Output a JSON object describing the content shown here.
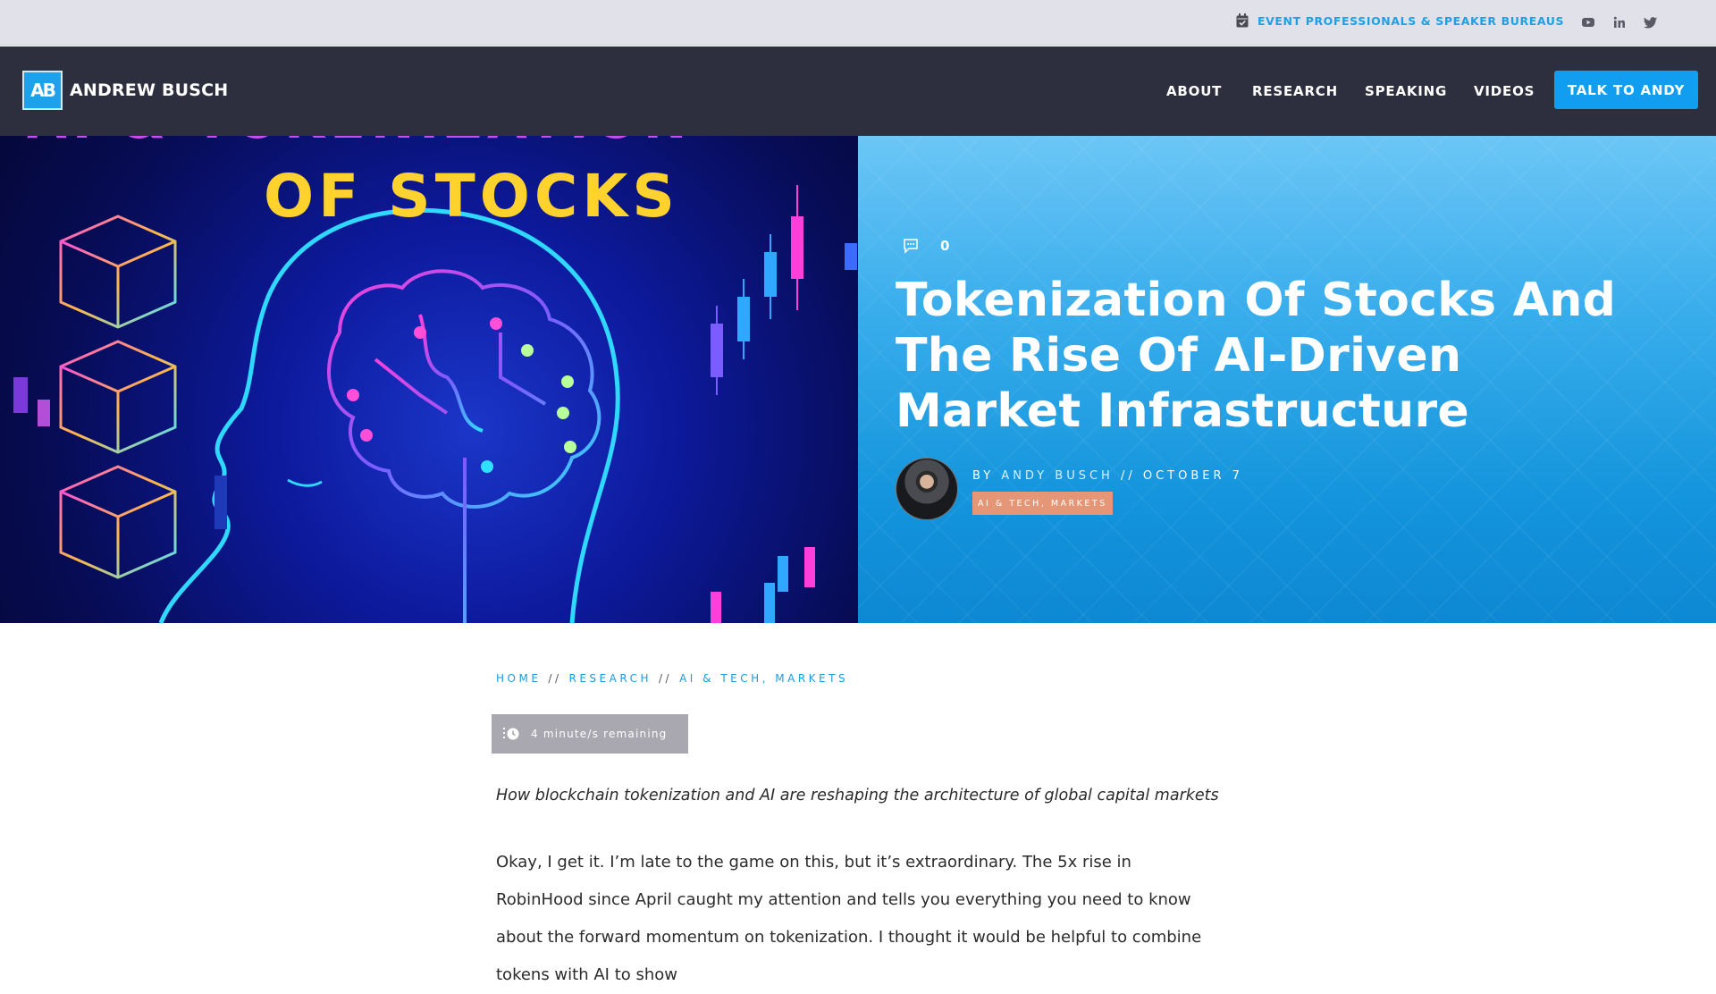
{
  "topbar": {
    "events_link": "EVENT PROFESSIONALS & SPEAKER BUREAUS",
    "events_icon": "calendar-check-icon",
    "social_icons": [
      "youtube-icon",
      "linkedin-icon",
      "twitter-icon"
    ]
  },
  "nav": {
    "logo_mark": "AB",
    "logo_name": "ANDREW BUSCH",
    "items": [
      "ABOUT",
      "RESEARCH",
      "SPEAKING",
      "VIDEOS"
    ],
    "cta": "TALK TO ANDY"
  },
  "hero": {
    "image_heading": "OF STOCKS",
    "comment_count": "0",
    "title": "Tokenization Of Stocks And The Rise Of AI-Driven Market Infrastructure",
    "by": "BY",
    "author": "ANDY BUSCH",
    "date_sep": "//",
    "date": "OCTOBER 7",
    "categories": "AI & TECH, MARKETS"
  },
  "content": {
    "breadcrumb": [
      "HOME",
      "RESEARCH",
      "AI & TECH, MARKETS"
    ],
    "breadcrumb_sep": "//",
    "reading_time": "4 minute/s remaining",
    "subtitle": "How blockchain tokenization and AI are reshaping the architecture of global capital markets",
    "body": "Okay, I get it. I’m late to the game on this, but it’s extraordinary. The 5x rise in RobinHood since April caught my attention and tells you everything you need to know about the forward momentum on tokenization. I thought it would be helpful to combine tokens with AI to show"
  },
  "colors": {
    "accent": "#119ef0",
    "nav_bg": "#2e2f3e",
    "topbar_bg": "#e1e1ea",
    "category_badge": "#e49676"
  }
}
